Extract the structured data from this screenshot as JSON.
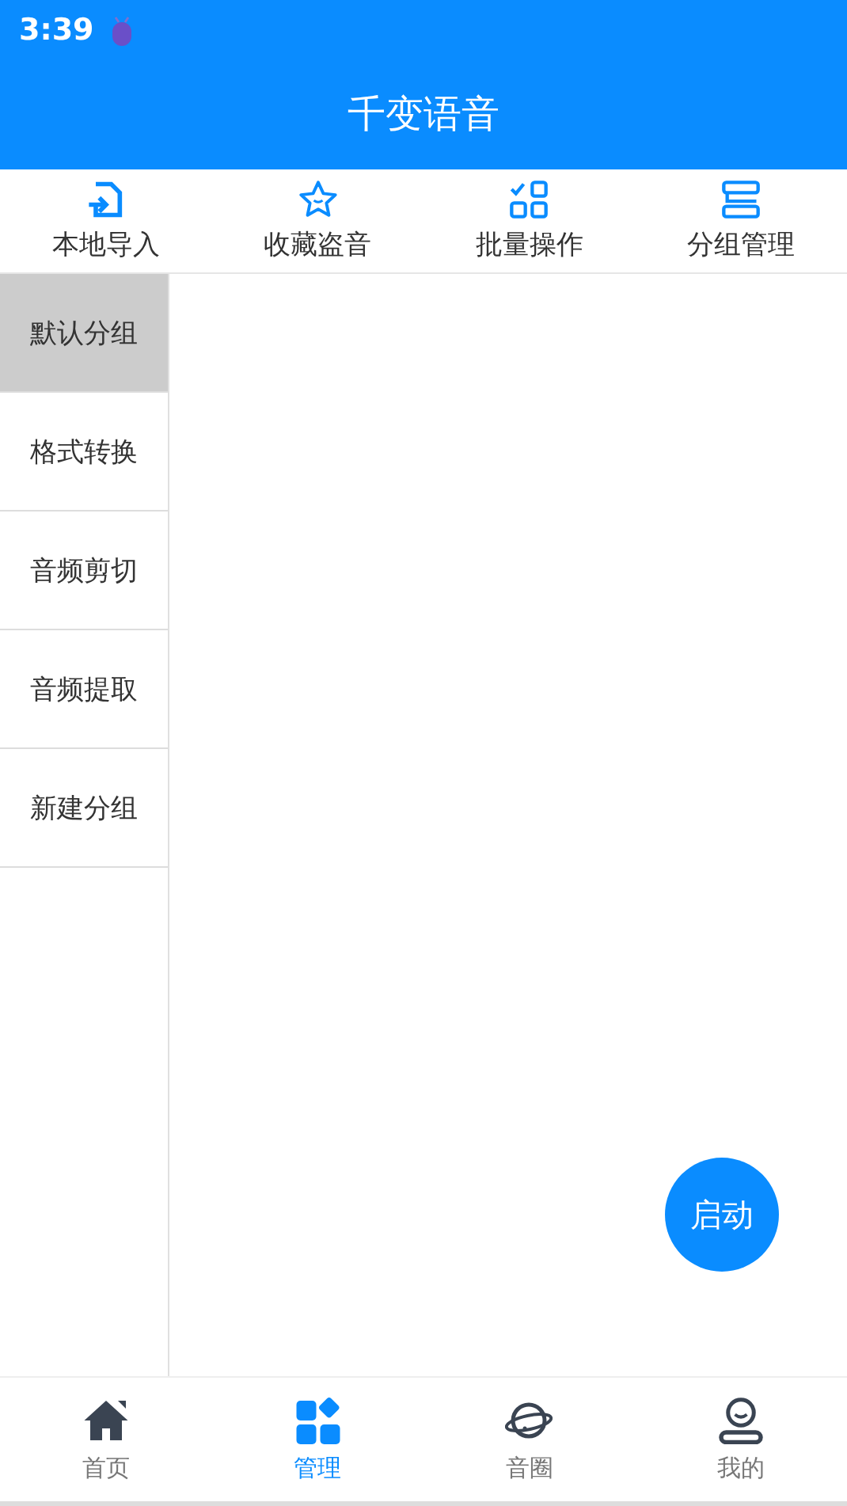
{
  "status_bar": {
    "time": "3:39"
  },
  "title": "千变语音",
  "toolbar": [
    {
      "kind": "import",
      "label": "本地导入"
    },
    {
      "kind": "star",
      "label": "收藏盗音"
    },
    {
      "kind": "batch",
      "label": "批量操作"
    },
    {
      "kind": "group",
      "label": "分组管理"
    }
  ],
  "sidebar": {
    "items": [
      {
        "label": "默认分组",
        "selected": true
      },
      {
        "label": "格式转换",
        "selected": false
      },
      {
        "label": "音频剪切",
        "selected": false
      },
      {
        "label": "音频提取",
        "selected": false
      },
      {
        "label": "新建分组",
        "selected": false
      }
    ]
  },
  "fab": {
    "label": "启动"
  },
  "tab_bar": [
    {
      "kind": "home",
      "label": "首页",
      "selected": false
    },
    {
      "kind": "manage",
      "label": "管理",
      "selected": true
    },
    {
      "kind": "planet",
      "label": "音圈",
      "selected": false
    },
    {
      "kind": "user",
      "label": "我的",
      "selected": false
    }
  ]
}
